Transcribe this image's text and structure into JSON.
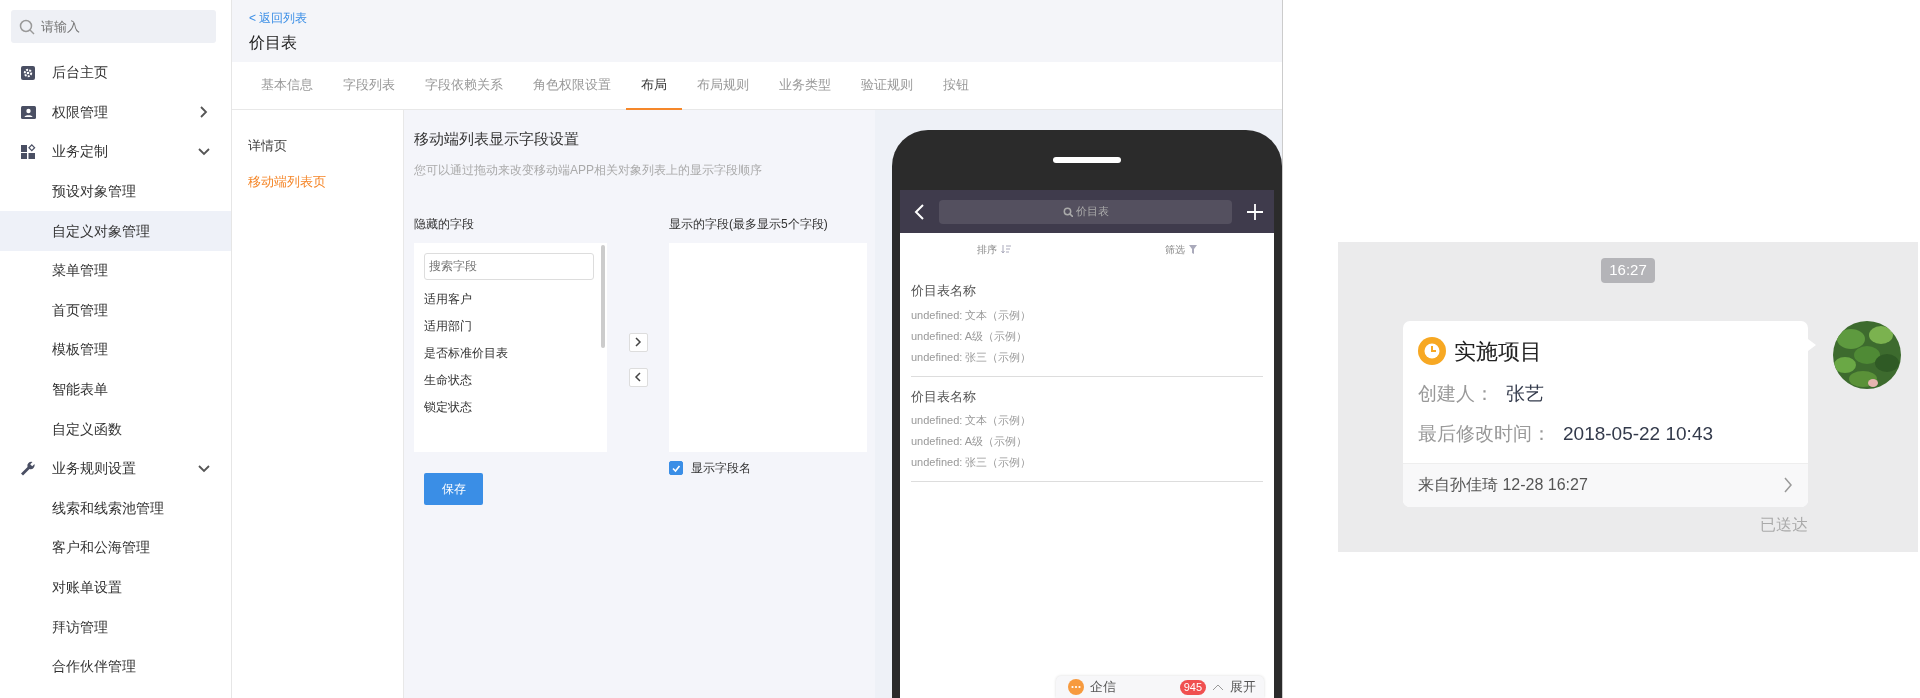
{
  "sidebar": {
    "search": {
      "placeholder": "请输入"
    },
    "items": [
      {
        "label": "后台主页",
        "selected": false
      },
      {
        "label": "权限管理",
        "expanded": false,
        "selected": false
      },
      {
        "label": "业务定制",
        "expanded": true,
        "selected": false,
        "children": [
          {
            "label": "预设对象管理",
            "selected": false
          },
          {
            "label": "自定义对象管理",
            "selected": true
          },
          {
            "label": "菜单管理",
            "selected": false
          },
          {
            "label": "首页管理",
            "selected": false
          },
          {
            "label": "模板管理",
            "selected": false
          },
          {
            "label": "智能表单",
            "selected": false
          },
          {
            "label": "自定义函数",
            "selected": false
          }
        ]
      },
      {
        "label": "业务规则设置",
        "expanded": true,
        "selected": false,
        "children": [
          {
            "label": "线索和线索池管理",
            "selected": false
          },
          {
            "label": "客户和公海管理",
            "selected": false
          },
          {
            "label": "对账单设置",
            "selected": false
          },
          {
            "label": "拜访管理",
            "selected": false
          },
          {
            "label": "合作伙伴管理",
            "selected": false
          }
        ]
      }
    ]
  },
  "header": {
    "back_link": "< 返回列表",
    "title": "价目表"
  },
  "tabs": [
    {
      "label": "基本信息",
      "selected": false
    },
    {
      "label": "字段列表",
      "selected": false
    },
    {
      "label": "字段依赖关系",
      "selected": false
    },
    {
      "label": "角色权限设置",
      "selected": false
    },
    {
      "label": "布局",
      "selected": true
    },
    {
      "label": "布局规则",
      "selected": false
    },
    {
      "label": "业务类型",
      "selected": false
    },
    {
      "label": "验证规则",
      "selected": false
    },
    {
      "label": "按钮",
      "selected": false
    }
  ],
  "subnav": [
    {
      "label": "详情页",
      "selected": false
    },
    {
      "label": "移动端列表页",
      "selected": true
    }
  ],
  "panel": {
    "title": "移动端列表显示字段设置",
    "description": "您可以通过拖动来改变移动端APP相关对象列表上的显示字段顺序",
    "hidden_label": "隐藏的字段",
    "field_search": {
      "placeholder": "搜索字段"
    },
    "hidden_fields": [
      "适用客户",
      "适用部门",
      "是否标准价目表",
      "生命状态",
      "锁定状态"
    ],
    "shown_label": "显示的字段(最多显示5个字段)",
    "show_field_names": {
      "label": "显示字段名",
      "checked": true
    },
    "save_button": "保存"
  },
  "phone": {
    "search": "价目表",
    "sort": "排序",
    "filter": "筛选",
    "records": [
      {
        "title": "价目表名称",
        "lines": [
          "undefined: 文本（示例）",
          "undefined: A级（示例）",
          "undefined: 张三（示例）"
        ]
      },
      {
        "title": "价目表名称",
        "lines": [
          "undefined: 文本（示例）",
          "undefined: A级（示例）",
          "undefined: 张三（示例）"
        ]
      }
    ],
    "widget": {
      "name": "企信",
      "badge": "945",
      "expand": "展开"
    }
  },
  "chat": {
    "time": "16:27",
    "card": {
      "title": "实施项目",
      "fields": [
        {
          "label": "创建人：",
          "value": "张艺"
        },
        {
          "label": "最后修改时间：",
          "value": "2018-05-22 10:43"
        }
      ],
      "footer": "来自孙佳琦 12-28 16:27"
    },
    "status": "已送达"
  }
}
